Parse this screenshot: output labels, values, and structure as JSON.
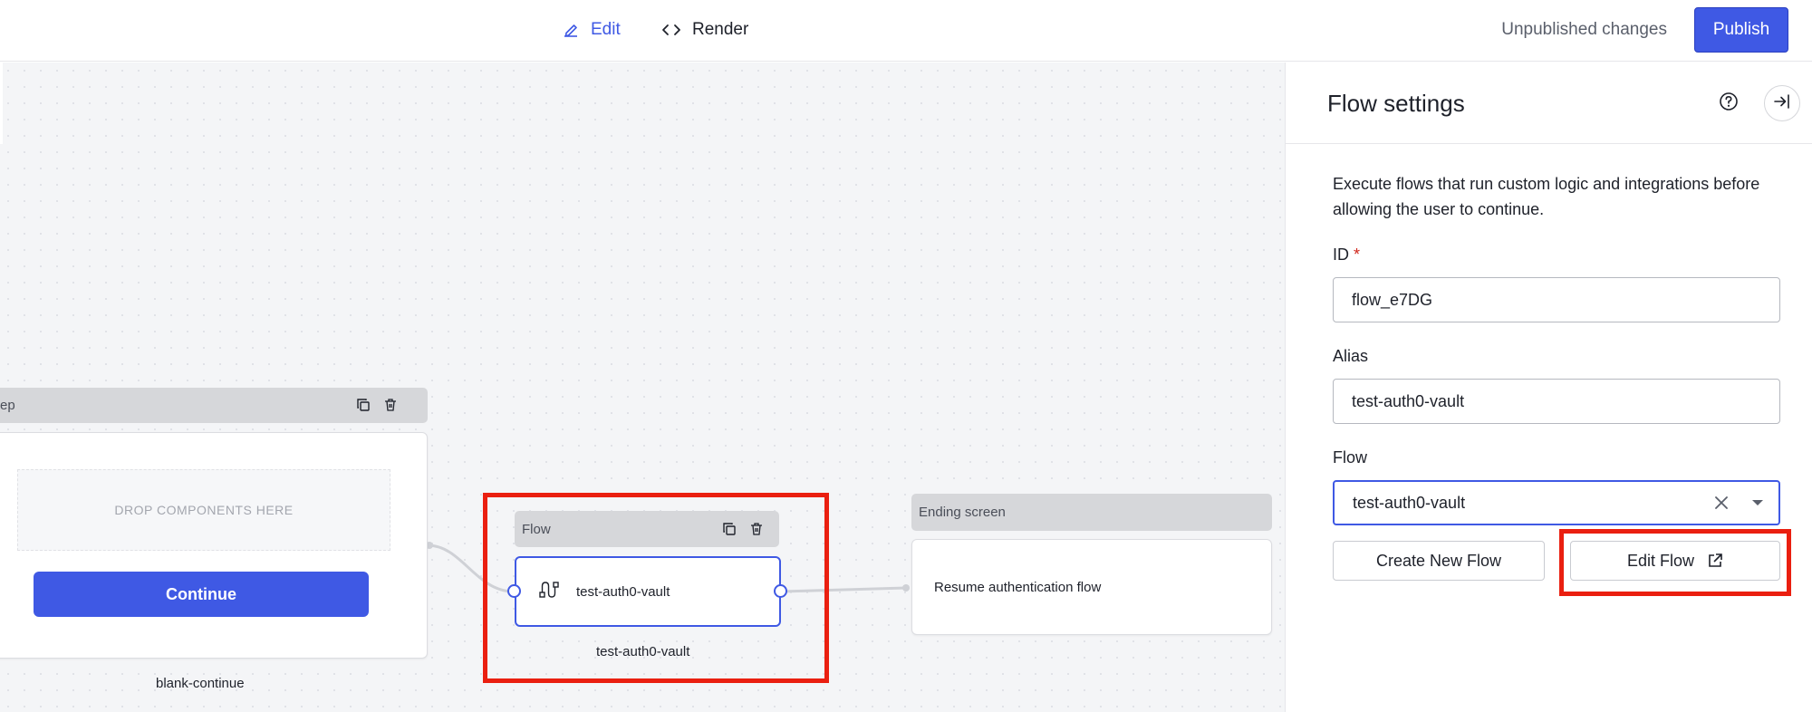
{
  "topbar": {
    "tabs": [
      {
        "label": "Edit",
        "icon": "pencil-icon",
        "active": true
      },
      {
        "label": "Render",
        "icon": "code-icon",
        "active": false
      }
    ],
    "status_text": "Unpublished changes",
    "publish_label": "Publish"
  },
  "canvas": {
    "step_node": {
      "title_partial": "ep",
      "dropzone_text": "DROP COMPONENTS HERE",
      "button_label": "Continue",
      "caption": "blank-continue"
    },
    "flow_node": {
      "header": "Flow",
      "label": "test-auth0-vault",
      "caption": "test-auth0-vault"
    },
    "ending_node": {
      "header": "Ending screen",
      "body": "Resume authentication flow"
    }
  },
  "panel": {
    "title": "Flow settings",
    "description": "Execute flows that run custom logic and integrations before allowing the user to continue.",
    "fields": {
      "id": {
        "label": "ID",
        "required_mark": "*",
        "value": "flow_e7DG"
      },
      "alias": {
        "label": "Alias",
        "value": "test-auth0-vault"
      },
      "flow": {
        "label": "Flow",
        "value": "test-auth0-vault"
      }
    },
    "buttons": {
      "create": "Create New Flow",
      "edit": "Edit Flow"
    }
  },
  "colors": {
    "accent": "#3f59e4",
    "highlight": "#ea1f10",
    "canvas": "#f4f5f7"
  }
}
